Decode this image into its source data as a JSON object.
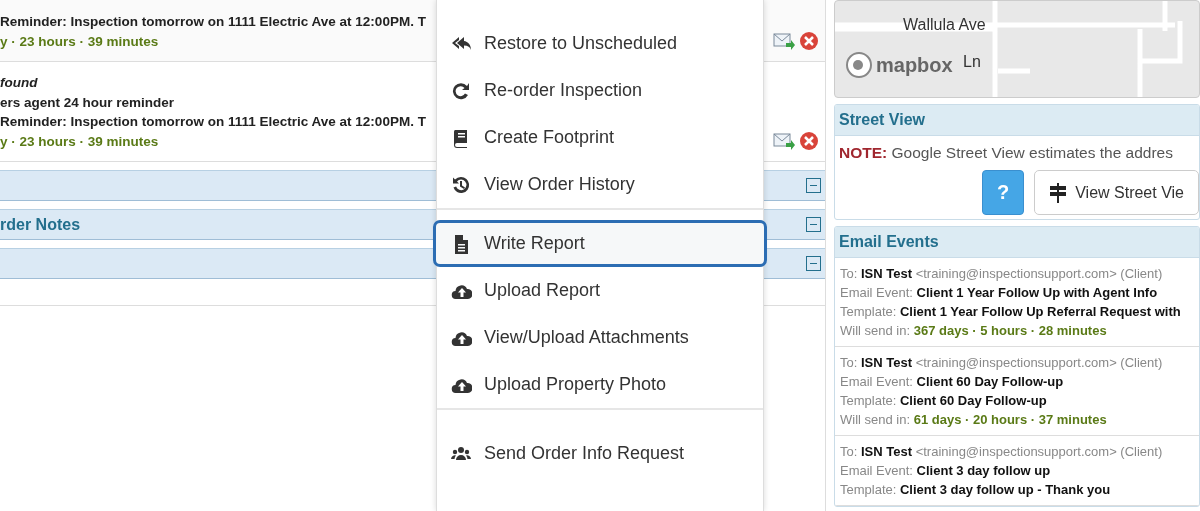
{
  "left_panel": {
    "events": [
      {
        "lines": [
          {
            "kind": "text",
            "text": "Reminder: Inspection tomorrow on 1111 Electric Ave at 12:00PM. T"
          },
          {
            "kind": "time",
            "text": "y · 23 hours · 39 minutes"
          }
        ]
      },
      {
        "lines": [
          {
            "kind": "italic",
            "text": "found"
          },
          {
            "kind": "text",
            "text": "ers agent 24 hour reminder"
          },
          {
            "kind": "text",
            "text": "Reminder: Inspection tomorrow on 1111 Electric Ave at 12:00PM. T"
          },
          {
            "kind": "time",
            "text": "y · 23 hours · 39 minutes"
          }
        ]
      }
    ],
    "sections": [
      {
        "expanded": true
      },
      {
        "title": "rder Notes",
        "expanded": true
      },
      {
        "expanded": true
      }
    ]
  },
  "context_menu": {
    "groups": [
      [
        {
          "label": "Restore to Unscheduled",
          "selected": false
        },
        {
          "label": "Re-order Inspection",
          "selected": false
        },
        {
          "label": "Create Footprint",
          "selected": false
        },
        {
          "label": "View Order History",
          "selected": false
        }
      ],
      [
        {
          "label": "Write Report",
          "selected": true
        },
        {
          "label": "Upload Report",
          "selected": false
        },
        {
          "label": "View/Upload Attachments",
          "selected": false
        },
        {
          "label": "Upload Property Photo",
          "selected": false
        }
      ],
      [
        {
          "label": "Send Order Info Request",
          "selected": false
        }
      ]
    ]
  },
  "map": {
    "street_labels": [
      "Wallula Ave",
      "Ln"
    ],
    "logo": "mapbox"
  },
  "street_view": {
    "title": "Street View",
    "note_label": "NOTE:",
    "note": "Google Street View estimates the addres",
    "help_button": "?",
    "view_button": "View Street Vie"
  },
  "email_events": {
    "title": "Email Events",
    "events": [
      {
        "to_label": "To:",
        "to_name": "ISN Test",
        "to_rest": "<training@inspectionsupport.com> (Client)",
        "event_label": "Email Event:",
        "event": "Client 1 Year Follow Up with Agent Info",
        "template_label": "Template:",
        "template": "Client 1 Year Follow Up Referral Request with",
        "send_label": "Will send in:",
        "send": "367 days · 5 hours · 28 minutes"
      },
      {
        "to_label": "To:",
        "to_name": "ISN Test",
        "to_rest": "<training@inspectionsupport.com> (Client)",
        "event_label": "Email Event:",
        "event": "Client 60 Day Follow-up",
        "template_label": "Template:",
        "template": "Client 60 Day Follow-up",
        "send_label": "Will send in:",
        "send": "61 days · 20 hours · 37 minutes"
      },
      {
        "to_label": "To:",
        "to_name": "ISN Test",
        "to_rest": "<training@inspectionsupport.com> (Client)",
        "event_label": "Email Event:",
        "event": "Client 3 day follow up",
        "template_label": "Template:",
        "template": "Client 3 day follow up - Thank you"
      }
    ]
  }
}
